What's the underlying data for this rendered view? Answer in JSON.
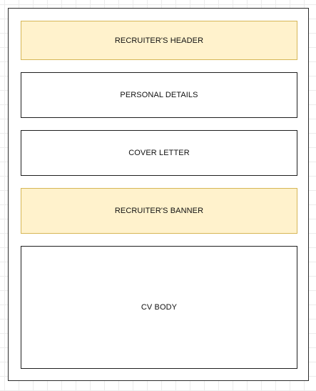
{
  "layout_diagram": {
    "blocks": [
      {
        "id": "recruiters-header",
        "label": "RECRUITER'S HEADER",
        "fill": "#fff2cc",
        "stroke": "#d6b656"
      },
      {
        "id": "personal-details",
        "label": "PERSONAL DETAILS",
        "fill": "#ffffff",
        "stroke": "#1f1f1f"
      },
      {
        "id": "cover-letter",
        "label": "COVER LETTER",
        "fill": "#ffffff",
        "stroke": "#1f1f1f"
      },
      {
        "id": "recruiters-banner",
        "label": "RECRUITER'S BANNER",
        "fill": "#fff2cc",
        "stroke": "#d6b656"
      },
      {
        "id": "cv-body",
        "label": "CV BODY",
        "fill": "#ffffff",
        "stroke": "#1f1f1f"
      }
    ]
  }
}
